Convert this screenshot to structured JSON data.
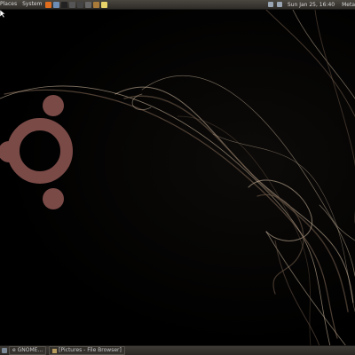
{
  "top_panel": {
    "menus": [
      "Places",
      "System"
    ],
    "launchers": [
      {
        "name": "firefox-icon",
        "color": "#e06c1e"
      },
      {
        "name": "mail-icon",
        "color": "#6e8db5"
      },
      {
        "name": "terminal-icon",
        "color": "#222222"
      },
      {
        "name": "app-icon",
        "color": "#555555"
      },
      {
        "name": "app-icon",
        "color": "#444444"
      },
      {
        "name": "app-icon",
        "color": "#666666"
      },
      {
        "name": "folder-icon",
        "color": "#a97b3a"
      },
      {
        "name": "notes-icon",
        "color": "#e7d36a"
      }
    ],
    "tray_icons": [
      "network-icon",
      "volume-icon"
    ],
    "clock": "Sun Jan 25, 16:40",
    "user": "Meta"
  },
  "desktop": {
    "wallpaper_colors": {
      "logo": "#7a4a47",
      "swirl_light": "#d8c3a8",
      "swirl_dark": "#6d5848"
    }
  },
  "bottom_panel": {
    "tasks": [
      {
        "label": "e GNOME..."
      },
      {
        "label": "[Pictures - File Browser]"
      }
    ]
  }
}
